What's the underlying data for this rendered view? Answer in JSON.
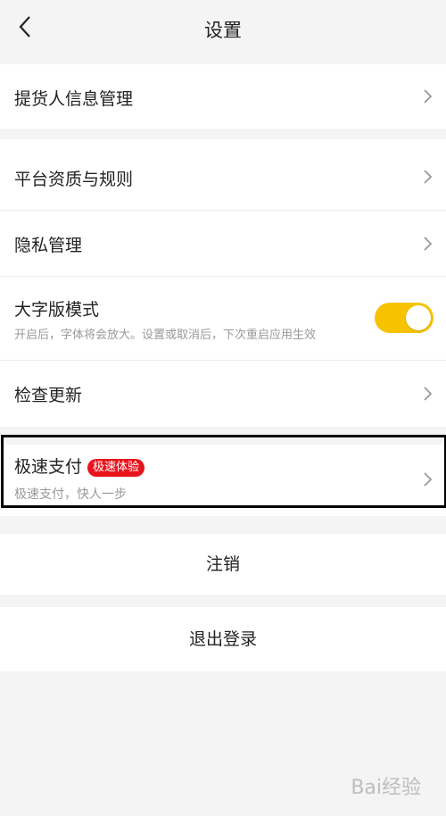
{
  "header": {
    "title": "设置"
  },
  "groups": {
    "pickup": {
      "label": "提货人信息管理"
    },
    "platform": {
      "label": "平台资质与规则"
    },
    "privacy": {
      "label": "隐私管理"
    },
    "large_font": {
      "label": "大字版模式",
      "description": "开启后，字体将会放大。设置或取消后，下次重启应用生效",
      "enabled": true
    },
    "update": {
      "label": "检查更新"
    },
    "fast_pay": {
      "label": "极速支付",
      "badge": "极速体验",
      "description": "极速支付，快人一步"
    }
  },
  "actions": {
    "deregister": "注销",
    "logout": "退出登录"
  },
  "watermark": {
    "text": "Bai经验"
  },
  "colors": {
    "toggle_on": "#f7c300",
    "badge": "#e8141d"
  }
}
